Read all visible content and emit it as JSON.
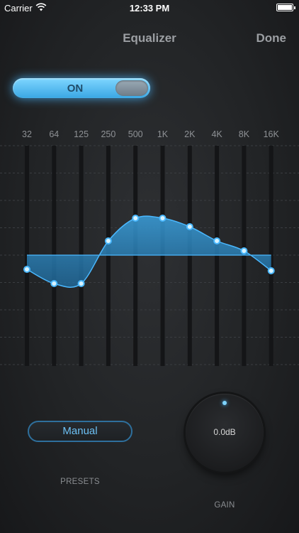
{
  "status_bar": {
    "carrier": "Carrier",
    "time": "12:33 PM",
    "battery_level": 1.0
  },
  "nav": {
    "title": "Equalizer",
    "done_label": "Done"
  },
  "toggle": {
    "label": "ON",
    "state": "on"
  },
  "equalizer": {
    "bands": [
      "32",
      "64",
      "125",
      "250",
      "500",
      "1K",
      "2K",
      "4K",
      "8K",
      "16K"
    ],
    "levels": [
      -0.5,
      -1.0,
      -1.0,
      0.5,
      1.3,
      1.3,
      1.0,
      0.5,
      0.15,
      -0.55
    ],
    "accent_color": "#4ab8ff"
  },
  "presets": {
    "current": "Manual",
    "caption": "PRESETS"
  },
  "gain": {
    "value": "0.0dB",
    "caption": "GAIN"
  }
}
